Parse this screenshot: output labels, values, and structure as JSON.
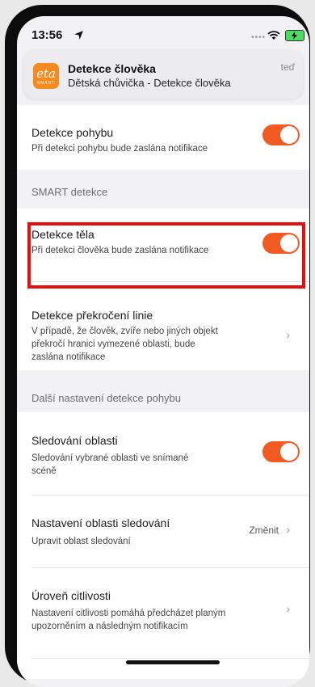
{
  "status_bar": {
    "time": "13:56"
  },
  "notification": {
    "app_logo_text": "eta",
    "app_logo_sub": "SMART",
    "title": "Detekce člověka",
    "body": "Dětská chůvička - Detekce člověka",
    "time": "teď"
  },
  "motion": {
    "title": "Detekce pohybu",
    "subtitle": "Při detekci pohybu bude zaslána notifikace",
    "enabled": true
  },
  "smart_section": {
    "label": "SMART detekce"
  },
  "body_detection": {
    "title": "Detekce těla",
    "subtitle": "Při detekci člověka bude zaslána notifikace",
    "enabled": true
  },
  "line_crossing": {
    "title": "Detekce překročení linie",
    "subtitle_lines": [
      "V případě, že člověk, zvíře nebo jiných objekt",
      "překročí hranici vymezené oblasti, bude",
      "zaslána notifikace"
    ]
  },
  "more_section": {
    "label": "Další nastavení detekce pohybu"
  },
  "area_tracking": {
    "title": "Sledování oblasti",
    "subtitle_lines": [
      "Sledování vybrané oblasti ve snímané",
      "scéně"
    ],
    "enabled": true
  },
  "tracking_area_settings": {
    "title": "Nastavení oblasti sledování",
    "subtitle": "Upravit oblast sledování",
    "action": "Změnit"
  },
  "sensitivity": {
    "title": "Úroveň citlivosti",
    "subtitle_lines": [
      "Nastavení citlivosti pomáhá předcházet planým",
      "upozorněním a následným notifikacím"
    ]
  },
  "colors": {
    "accent": "#f25a22",
    "highlight": "#e01010",
    "logo": "#f58a1f"
  },
  "icons": {
    "location": "location-arrow-icon",
    "wifi": "wifi-icon",
    "battery": "battery-charging-icon",
    "chevron": "chevron-right-icon"
  }
}
